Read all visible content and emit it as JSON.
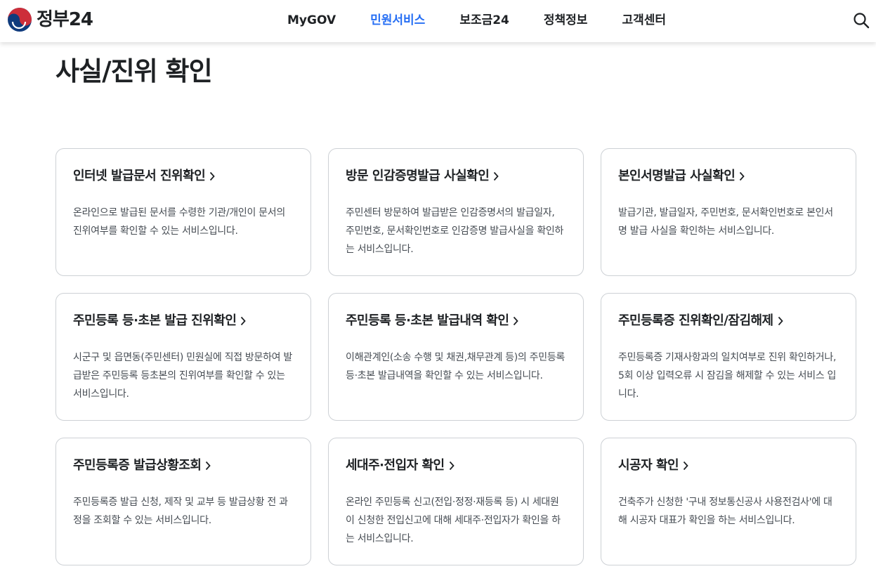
{
  "header": {
    "logo_text": "정부24",
    "nav": [
      "MyGOV",
      "민원서비스",
      "보조금24",
      "정책정보",
      "고객센터"
    ],
    "active_nav": 1
  },
  "page": {
    "title": "사실/진위 확인"
  },
  "cards": [
    {
      "title": "인터넷 발급문서 진위확인",
      "desc": "온라인으로 발급된 문서를 수령한 기관/개인이 문서의 진위여부를 확인할 수 있는 서비스입니다."
    },
    {
      "title": "방문 인감증명발급 사실확인",
      "desc": "주민센터 방문하여 발급받은 인감증명서의 발급일자, 주민번호, 문서확인번호로 인감증명 발급사실을 확인하는 서비스입니다."
    },
    {
      "title": "본인서명발급 사실확인",
      "desc": "발급기관, 발급일자, 주민번호, 문서확인번호로 본인서명 발급 사실을 확인하는 서비스입니다."
    },
    {
      "title": "주민등록 등·초본 발급 진위확인",
      "desc": "시군구 및 읍면동(주민센터) 민원실에 직접 방문하여 발급받은 주민등록 등초본의 진위여부를 확인할 수 있는 서비스입니다."
    },
    {
      "title": "주민등록 등·초본 발급내역 확인",
      "desc": "이해관계인(소송 수행 및 채권,채무관계 등)의 주민등록 등·초본 발급내역을 확인할 수 있는 서비스입니다."
    },
    {
      "title": "주민등록증 진위확인/잠김해제",
      "desc": "주민등록증 기재사항과의 일치여부로 진위 확인하거나, 5회 이상 입력오류 시 잠김을 해제할 수 있는 서비스 입니다."
    },
    {
      "title": "주민등록증 발급상황조회",
      "desc": "주민등록증 발급 신청, 제작 및 교부 등 발급상황 전 과정을 조회할 수 있는 서비스입니다."
    },
    {
      "title": "세대주·전입자 확인",
      "desc": "온라인 주민등록 신고(전입·정정·재등록 등) 시 세대원이 신청한 전입신고에 대해 세대주·전입자가 확인을 하는 서비스입니다."
    },
    {
      "title": "시공자 확인",
      "desc": "건축주가 신청한 '구내 정보통신공사 사용전검사'에 대해 시공자 대표가 확인을 하는 서비스입니다."
    }
  ],
  "colors": {
    "accent": "#256ef4",
    "text": "#1e2124",
    "desc_text": "#464c53",
    "card_border": "#cdd1d5",
    "logo_red": "#cd2e3a",
    "logo_blue": "#0f3b7d"
  },
  "icons": {
    "logo": "taegeuk-icon",
    "search": "search-icon",
    "card_arrow": "chevron-right-icon"
  }
}
